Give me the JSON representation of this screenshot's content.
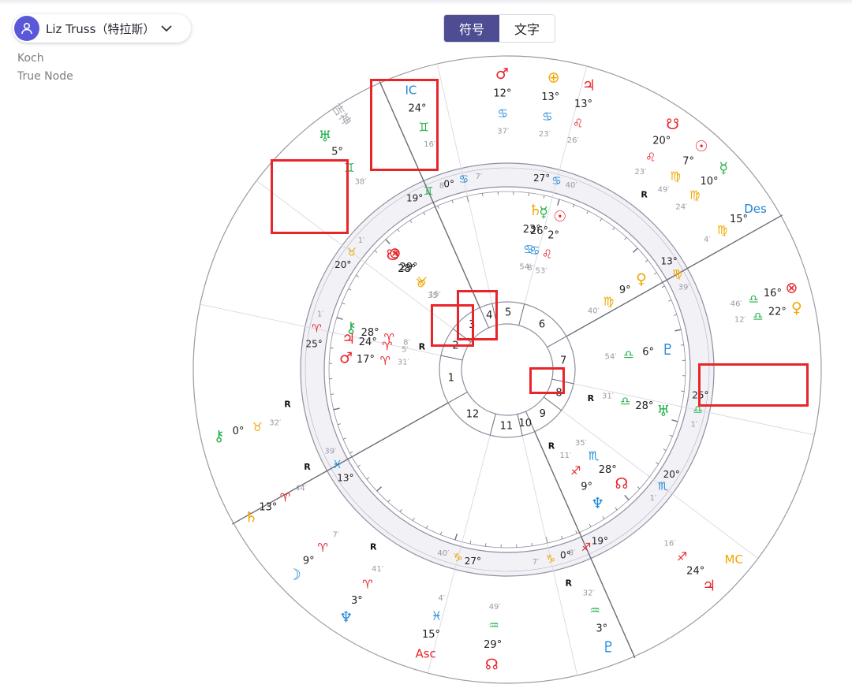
{
  "header": {
    "person_name": "Liz Truss（特拉斯）",
    "house_system": "Koch",
    "node_type": "True Node",
    "toggle": [
      {
        "label": "符号",
        "active": true
      },
      {
        "label": "文字",
        "active": false
      }
    ]
  },
  "colors": {
    "accent": "#4e4c92",
    "avatar": "#5a58d8",
    "fire": "#e8252a",
    "earth": "#f0a800",
    "air": "#23b04a",
    "water": "#1a86d8",
    "highlight": "#e8252a"
  },
  "chart": {
    "asc_deg": 13,
    "cusps": [
      {
        "house": 1,
        "sign": "pisces",
        "deg": "13",
        "min": "39",
        "color": "water"
      },
      {
        "house": 2,
        "sign": "aries",
        "deg": "25",
        "min": "1",
        "color": "fire"
      },
      {
        "house": 3,
        "sign": "taurus",
        "deg": "20",
        "min": "1",
        "color": "earth"
      },
      {
        "house": 4,
        "sign": "gemini",
        "deg": "19",
        "min": "8",
        "color": "air"
      },
      {
        "house": 5,
        "sign": "cancer",
        "deg": "0",
        "min": "7",
        "color": "water"
      },
      {
        "house": 6,
        "sign": "cancer",
        "deg": "27",
        "min": "40",
        "color": "water"
      },
      {
        "house": 7,
        "sign": "virgo",
        "deg": "13",
        "min": "39",
        "color": "earth"
      },
      {
        "house": 8,
        "sign": "libra",
        "deg": "25",
        "min": "1",
        "color": "air"
      },
      {
        "house": 9,
        "sign": "scorpio",
        "deg": "20",
        "min": "1",
        "color": "water"
      },
      {
        "house": 10,
        "sign": "sagittarius",
        "deg": "19",
        "min": "8",
        "color": "fire"
      },
      {
        "house": 11,
        "sign": "capricorn",
        "deg": "0",
        "min": "7",
        "color": "earth"
      },
      {
        "house": 12,
        "sign": "capricorn",
        "deg": "27",
        "min": "40",
        "color": "earth"
      }
    ],
    "inner_planets": [
      {
        "glyph": "☉",
        "color": "fire",
        "lon": 122,
        "deg": "2",
        "sign": "leo",
        "min": "53"
      },
      {
        "glyph": "☿",
        "color": "air",
        "lon": 116,
        "deg": "26",
        "sign": "cancer",
        "min": "8"
      },
      {
        "glyph": "♄",
        "color": "earth",
        "lon": 113,
        "deg": "23",
        "sign": "cancer",
        "min": "54"
      },
      {
        "glyph": "♀",
        "color": "earth",
        "lon": 159,
        "deg": "9",
        "sign": "virgo",
        "min": "40"
      },
      {
        "glyph": "♇",
        "color": "water",
        "lon": 186,
        "deg": "6",
        "sign": "libra",
        "min": "54"
      },
      {
        "glyph": "♅",
        "color": "air",
        "lon": 208,
        "deg": "28",
        "sign": "libra",
        "min": "31",
        "retro": true
      },
      {
        "glyph": "♆",
        "color": "water",
        "lon": 249,
        "deg": "9",
        "sign": "sagittarius",
        "min": "11",
        "retro": true
      },
      {
        "glyph": "☊",
        "color": "fire",
        "lon": 238,
        "deg": "28",
        "sign": "scorpio",
        "min": "35"
      },
      {
        "glyph": "♂",
        "color": "fire",
        "lon": 17,
        "deg": "17",
        "sign": "aries",
        "min": "31"
      },
      {
        "glyph": "⚷",
        "color": "air",
        "lon": 28,
        "deg": "28",
        "sign": "aries",
        "min": "8"
      },
      {
        "glyph": "♃",
        "color": "fire",
        "lon": 24,
        "deg": "24",
        "sign": "aries",
        "min": "5",
        "retro": true
      },
      {
        "glyph": "⊗",
        "color": "fire",
        "lon": 59,
        "deg": "29",
        "sign": "taurus",
        "min": "15"
      },
      {
        "glyph": "☋",
        "color": "fire",
        "lon": 58,
        "deg": "28",
        "sign": "taurus",
        "min": "35"
      }
    ],
    "outer_planets": [
      {
        "glyph": "♂",
        "color": "fire",
        "lon": 102,
        "deg": "12",
        "sign": "cancer",
        "min": "37"
      },
      {
        "glyph": "IC",
        "color": "water",
        "lon": 84,
        "deg": "24",
        "sign": "gemini",
        "min": "16"
      },
      {
        "glyph": "♅",
        "color": "air",
        "lon": 65,
        "deg": "5",
        "sign": "gemini",
        "min": "38"
      },
      {
        "glyph": "⚷",
        "color": "air",
        "lon": 0,
        "deg": "0",
        "sign": "taurus",
        "min": "32",
        "retro": true
      },
      {
        "glyph": "♄",
        "color": "earth",
        "lon": 343,
        "deg": "13",
        "sign": "aries",
        "min": "44",
        "retro": true
      },
      {
        "glyph": "☽",
        "color": "water",
        "lon": 329,
        "deg": "9",
        "sign": "aries",
        "min": "7"
      },
      {
        "glyph": "♆",
        "color": "water",
        "lon": 316,
        "deg": "3",
        "sign": "aries",
        "min": "41",
        "retro": true
      },
      {
        "glyph": "Asc",
        "color": "fire",
        "lon": 299,
        "deg": "15",
        "sign": "pisces",
        "min": "4"
      },
      {
        "glyph": "☊",
        "color": "fire",
        "lon": 286,
        "deg": "29",
        "sign": "aquarius",
        "min": "49"
      },
      {
        "glyph": "♇",
        "color": "water",
        "lon": 263,
        "deg": "3",
        "sign": "aquarius",
        "min": "32",
        "retro": true
      },
      {
        "glyph": "♃",
        "color": "fire",
        "lon": 240,
        "deg": "24",
        "sign": "sagittarius",
        "min": "16"
      },
      {
        "glyph": "MC",
        "color": "earth",
        "lon": 233,
        "deg": "",
        "sign": "",
        "min": ""
      },
      {
        "glyph": "⊗",
        "color": "fire",
        "lon": 177,
        "deg": "16",
        "sign": "libra",
        "min": "46"
      },
      {
        "glyph": "♀",
        "color": "earth",
        "lon": 181,
        "deg": "22",
        "sign": "libra",
        "min": "12"
      },
      {
        "glyph": "Des",
        "color": "water",
        "lon": 160,
        "deg": "15",
        "sign": "virgo",
        "min": "4"
      },
      {
        "glyph": "☿",
        "color": "air",
        "lon": 150,
        "deg": "10",
        "sign": "virgo",
        "min": "24"
      },
      {
        "glyph": "☉",
        "color": "fire",
        "lon": 144,
        "deg": "7",
        "sign": "virgo",
        "min": "49"
      },
      {
        "glyph": "☋",
        "color": "fire",
        "lon": 137,
        "deg": "20",
        "sign": "leo",
        "min": "23",
        "retro": true
      },
      {
        "glyph": "♃",
        "color": "fire",
        "lon": 119,
        "deg": "13",
        "sign": "leo",
        "min": "26"
      },
      {
        "glyph": "⊕",
        "color": "earth",
        "lon": 112,
        "deg": "13",
        "sign": "cancer",
        "min": "23"
      }
    ],
    "side_label": "吉神",
    "house_numbers": [
      "1",
      "2",
      "3",
      "4",
      "5",
      "6",
      "7",
      "8",
      "9",
      "10",
      "11",
      "12"
    ]
  },
  "sign_glyphs": {
    "aries": "♈",
    "taurus": "♉",
    "gemini": "♊",
    "cancer": "♋",
    "leo": "♌",
    "virgo": "♍",
    "libra": "♎",
    "scorpio": "♏",
    "sagittarius": "♐",
    "capricorn": "♑",
    "aquarius": "♒",
    "pisces": "♓"
  },
  "retrograde_mark": "R"
}
